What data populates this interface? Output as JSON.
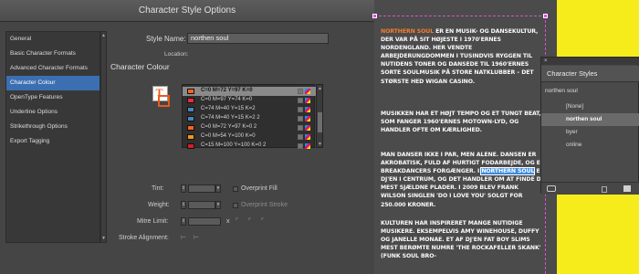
{
  "dialog": {
    "title": "Character Style Options",
    "categories": [
      "General",
      "Basic Character Formats",
      "Advanced Character Formats",
      "Character Colour",
      "OpenType Features",
      "Underline Options",
      "Strikethrough Options",
      "Export Tagging"
    ],
    "selected_category": "Character Colour",
    "style_name_label": "Style Name:",
    "style_name_value": "northen soul",
    "location_label": "Location:",
    "section_title": "Character Colour",
    "swatches": [
      {
        "name": "C=0 M=72 Y=97 K=0",
        "color": "#f26522",
        "selected": true
      },
      {
        "name": "C=0 M=97 Y=74 K=0",
        "color": "#ee2a3c",
        "selected": false
      },
      {
        "name": "C=74 M=40 Y=15 K=2",
        "color": "#4a86b7",
        "selected": false
      },
      {
        "name": "C=74 M=40 Y=15 K=2 2",
        "color": "#4a86b7",
        "selected": false
      },
      {
        "name": "C=0 M=72 Y=97 K=0 2",
        "color": "#f26522",
        "selected": false
      },
      {
        "name": "C=0 M=54 Y=100 K=0",
        "color": "#f7941d",
        "selected": false
      },
      {
        "name": "C=15 M=100 Y=100 K=0 2",
        "color": "#d31f26",
        "selected": false
      }
    ],
    "tint_label": "Tint:",
    "overprint_fill_label": "Overprint Fill",
    "weight_label": "Weight:",
    "overprint_stroke_label": "Overprint Stroke",
    "mitre_limit_label": "Mitre Limit:",
    "mitre_x": "x",
    "stroke_alignment_label": "Stroke Alignment:"
  },
  "page": {
    "paragraphs": [
      {
        "accent": "NORTHERN SOUL",
        "text": " ER EN MUSIK- OG DANSEKULTUR, DER VAR PÅ SIT HØJESTE I 1970'ERNES NORDENGLAND. HER VENDTE ARBEJDERUNGDOMMEN I TUSINDVIS RYGGEN TIL NUTIDENS TONER OG DANSEDE TIL 1960'ERNES SORTE SOULMUSIK PÅ STORE NATKLUBBER – DET STØRSTE HED WIGAN CASINO."
      },
      {
        "text": "MUSIKKEN HAR ET HØJT TEMPO OG ET TUNGT BEAT, SOM FANGER 1960'ERNES MOTOWN-LYD, OG HANDLER OFTE OM KÆRLIGHED."
      },
      {
        "before": "MAN DANSER IKKE I PAR, MEN ALENE. DANSEN ER AKROBATISK, FULD AF HURTIGT FODARBEJDE, OG ER BREAKDANCERS FORGÆNGER. I ",
        "highlight": "NORTHERN SOUL",
        "after": " ER DJ'EN I CENTRUM, OG DET HANDLER OM AT FINDE DE MEST SJÆLDNE PLADER. I 2009 BLEV FRANK WILSON SINGLEN 'DO I LOVE YOU' SOLGT FOR 250.000 KRONER."
      },
      {
        "text": "KULTUREN HAR INSPIRERET MANGE NUTIDIGE MUSIKERE. EKSEMPELVIS AMY WINEHOUSE, DUFFY OG JANELLE MONAE. ET AF DJ'EN FAT BOY SLIMS MEST BERØMTE NUMRE 'THE ROCKAFELLER SKANK' (FUNK SOUL BRO-"
      }
    ]
  },
  "char_styles_panel": {
    "close_glyph": "×",
    "title": "Character Styles",
    "current": "northen soul",
    "items": [
      {
        "label": "[None]",
        "selected": false
      },
      {
        "label": "northen soul",
        "selected": true
      },
      {
        "label": "byer",
        "selected": false
      },
      {
        "label": "online",
        "selected": false
      }
    ]
  }
}
